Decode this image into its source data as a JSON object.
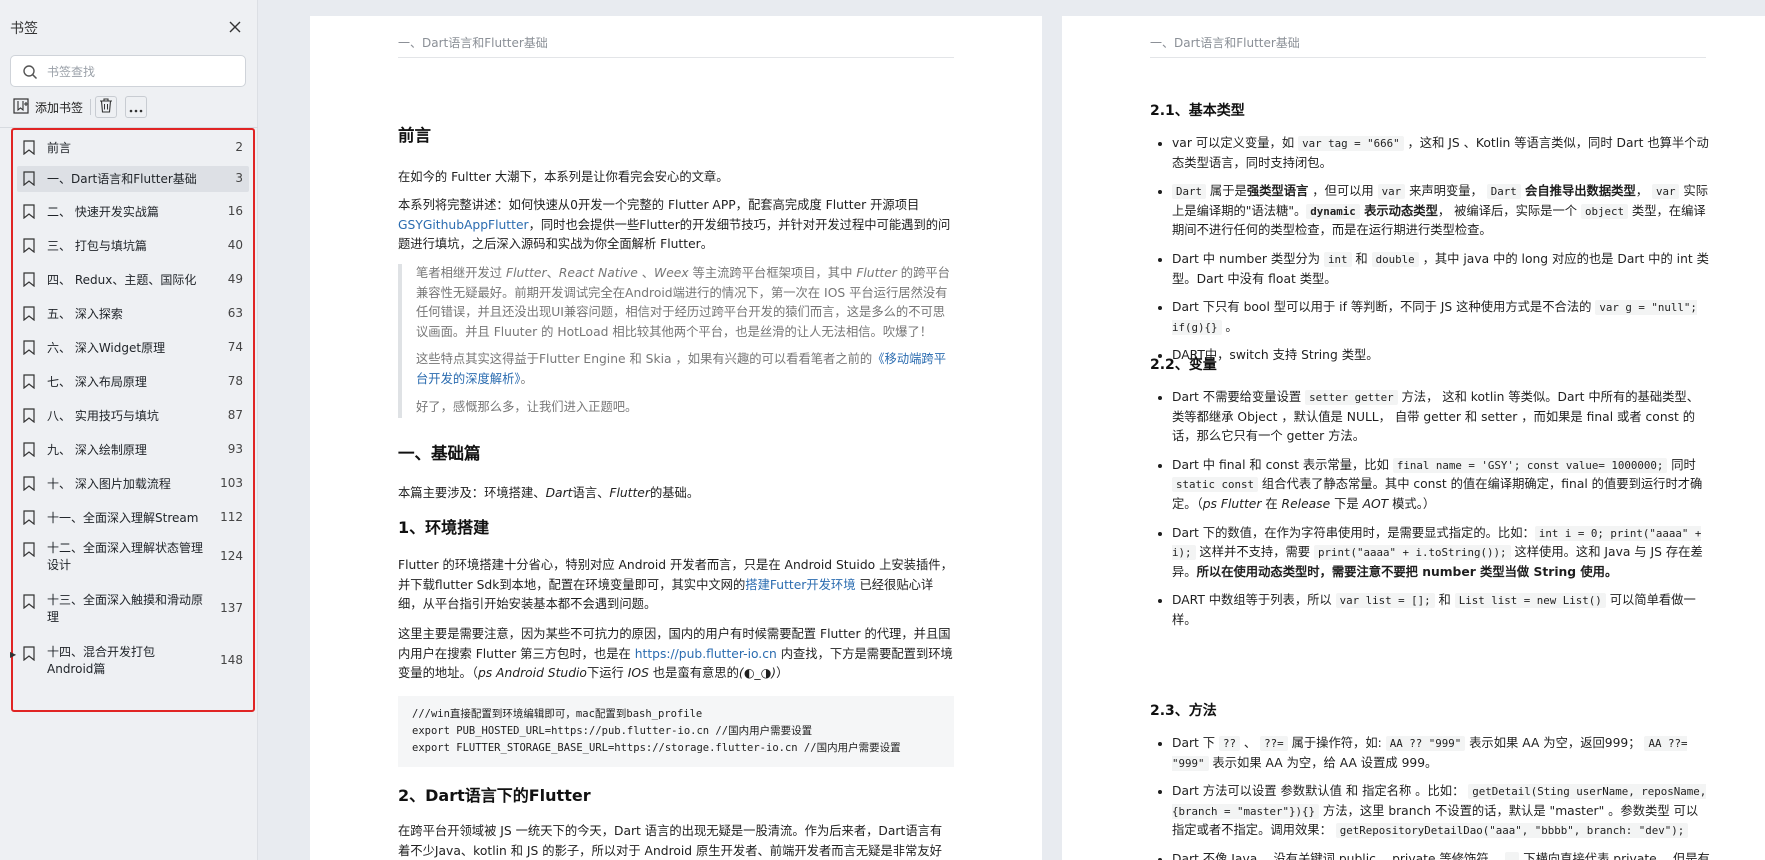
{
  "sidebar": {
    "title": "书签",
    "search_placeholder": "书签查找",
    "add_label": "添加书签",
    "items": [
      {
        "label": "前言",
        "page": "2"
      },
      {
        "label": "一、Dart语言和Flutter基础",
        "page": "3"
      },
      {
        "label": "二、 快速开发实战篇",
        "page": "16"
      },
      {
        "label": "三、 打包与填坑篇",
        "page": "40"
      },
      {
        "label": "四、 Redux、主题、国际化",
        "page": "49"
      },
      {
        "label": "五、 深入探索",
        "page": "63"
      },
      {
        "label": "六、 深入Widget原理",
        "page": "74"
      },
      {
        "label": "七、 深入布局原理",
        "page": "78"
      },
      {
        "label": "八、 实用技巧与填坑",
        "page": "87"
      },
      {
        "label": "九、 深入绘制原理",
        "page": "93"
      },
      {
        "label": "十、 深入图片加载流程",
        "page": "103"
      },
      {
        "label": "十一、全面深入理解Stream",
        "page": "112"
      },
      {
        "label": "十二、全面深入理解状态管理设计",
        "page": "124"
      },
      {
        "label": "十三、全面深入触摸和滑动原理",
        "page": "137"
      },
      {
        "label": "十四、混合开发打包 Android篇",
        "page": "148"
      }
    ]
  },
  "left_page": {
    "running_head": "一、Dart语言和Flutter基础",
    "h_preface": "前言",
    "p1": "在如今的 Fultter 大潮下，本系列是让你看完会安心的文章。",
    "p2a": "本系列将完整讲述：如何快速从0开发一个完整的 Flutter APP，配套高完成度 Flutter 开源项目",
    "p2_link": "GSYGithubAppFlutter",
    "p2b": "，同时也会提供一些Flutter的开发细节技巧，并针对开发过程中可能遇到的问题进行填坑，之后深入源码和实战为你全面解析 Flutter。",
    "q1a": "笔者相继开发过 ",
    "q1_i1": "Flutter",
    "q1b": "、",
    "q1_i2": "React Native",
    "q1c": " 、",
    "q1_i3": "Weex",
    "q1d": " 等主流跨平台框架项目，其中 ",
    "q1_i4": "Flutter",
    "q1e": " 的跨平台兼容性无疑最好。前期开发调试完全在Android端进行的情况下，第一次在 IOS 平台运行居然没有任何错误，并且还没出现UI兼容问题，相信对于经历过跨平台开发的猿们而言，这是多么的不可思议画面。并且 Fluuter 的 HotLoad 相比较其他两个平台，也是丝滑的让人无法相信。吹爆了！",
    "q2a": "这些特点其实这得益于Flutter Engine 和 Skia ，如果有兴趣的可以看看笔者之前的",
    "q2_link": "《移动端跨平台开发的深度解析》",
    "q2b": "。",
    "q3": "好了，感慨那么多，让我们进入正题吧。",
    "h_basic": "一、基础篇",
    "p3a": "本篇主要涉及：环境搭建、",
    "p3_i1": "Dart",
    "p3b": "语言、",
    "p3_i2": "Flutter",
    "p3c": "的基础。",
    "h_env": "1、环境搭建",
    "p4a": "Flutter 的环境搭建十分省心，特别对应 Android 开发者而言，只是在 Android Stuido 上安装插件，并下载flutter Sdk到本地，配置在环境变量即可，其实中文网的",
    "p4_link": "搭建Futter开发环境",
    "p4b": " 已经很贴心详细，从平台指引开始安装基本都不会遇到问题。",
    "p5a": "这里主要是需要注意，因为某些不可抗力的原因，国内的用户有时候需要配置 Flutter 的代理，并且国内用户在搜索 Flutter 第三方包时，也是在 ",
    "p5_link": "https://pub.flutter-io.cn",
    "p5b": " 内查找，下方是需要配置到环境变量的地址。（",
    "p5_i": "ps Android Studio",
    "p5c": "下运行 ",
    "p5_i2": "IOS",
    "p5d": " 也是蛮有意思的",
    "p5_i3": "(◐_◑)",
    "p5e": "）",
    "code": "///win直接配置到环境编辑即可，mac配置到bash_profile\nexport PUB_HOSTED_URL=https://pub.flutter-io.cn //国内用户需要设置\nexport FLUTTER_STORAGE_BASE_URL=https://storage.flutter-io.cn //国内用户需要设置",
    "h_dart": "2、Dart语言下的Flutter",
    "p6": "在跨平台开领域被 JS 一统天下的今天，Dart 语言的出现无疑是一股清流。作为后来者，Dart语言有着不少Java、kotlin 和 JS 的影子，所以对于 Android 原生开发者、前端开发者而言无疑是非常友好的。"
  },
  "right_page": {
    "running_head": "一、Dart语言和Flutter基础",
    "h21": "2.1、基本类型",
    "b1a": "var 可以定义变量，如 ",
    "b1_c": "var tag = \"666\"",
    "b1b": " ，这和 JS 、Kotlin 等语言类似，同时 Dart 也算半个动态类型语言，同时支持闭包。",
    "b2_c1": "Dart",
    "b2a": " 属于是",
    "b2_b1": "强类型语言",
    "b2b": " ，但可以用 ",
    "b2_c2": "var",
    "b2c": " 来声明变量， ",
    "b2_c3": "Dart",
    "b2_b2": " 会自推导出数据类型",
    "b2d": "， ",
    "b2_c4": "var",
    "b2e": " 实际上是编译期的\"语法糖\"。",
    "b2_c5": "dynamic",
    "b2_b3": " 表示动态类型",
    "b2f": "， 被编译后，实际是一个 ",
    "b2_c6": "object",
    "b2g": " 类型，在编译期间不进行任何的类型检查，而是在运行期进行类型检查。",
    "b3a": "Dart 中 number 类型分为 ",
    "b3_c1": "int",
    "b3b": " 和 ",
    "b3_c2": "double",
    "b3c": " ，其中 java 中的 long 对应的也是 Dart 中的 int 类型。Dart 中没有 float 类型。",
    "b4a": "Dart 下只有 bool 型可以用于 if 等判断，不同于 JS 这种使用方式是不合法的 ",
    "b4_c": "var g = \"null\"; if(g){}",
    "b4b": " 。",
    "b5": "DART中，switch 支持 String 类型。",
    "h22": "2.2、变量",
    "c1a": "Dart 不需要给变量设置 ",
    "c1_c": "setter getter",
    "c1b": " 方法， 这和 kotlin 等类似。Dart 中所有的基础类型、类等都继承 Object ，默认值是 NULL， 自带 getter 和 setter ，而如果是 final 或者 const 的话，那么它只有一个 getter 方法。",
    "c2a": "Dart 中 final 和 const 表示常量，比如 ",
    "c2_c1": "final name = 'GSY'; const value= 1000000;",
    "c2b": " 同时 ",
    "c2_c2": "static const",
    "c2c": " 组合代表了静态常量。其中 const 的值在编译期确定，final 的值要到运行时才确定。（",
    "c2_i": "ps Flutter",
    "c2d": " 在 ",
    "c2_i2": "Release",
    "c2e": " 下是 ",
    "c2_i3": "AOT",
    "c2f": " 模式。）",
    "c3a": "Dart 下的数值，在作为字符串使用时，是需要显式指定的。比如：",
    "c3_c1": "int i = 0; print(\"aaaa\" + i);",
    "c3b": " 这样并不支持，需要 ",
    "c3_c2": "print(\"aaaa\" + i.toString());",
    "c3c": " 这样使用。这和 Java 与 JS 存在差异。",
    "c3_b": "所以在使用动态类型时，需要注意不要把 number 类型当做 String 使用。",
    "c4a": "DART 中数组等于列表，所以 ",
    "c4_c1": "var list = [];",
    "c4b": " 和 ",
    "c4_c2": "List list = new List()",
    "c4c": " 可以简单看做一样。",
    "h23": "2.3、方法",
    "d1a": "Dart 下 ",
    "d1_c1": "??",
    "d1b": " 、 ",
    "d1_c2": "??=",
    "d1c": " 属于操作符，如: ",
    "d1_c3": "AA ?? \"999\"",
    "d1d": " 表示如果 AA 为空，返回999； ",
    "d1_c4": "AA ??= \"999\"",
    "d1e": " 表示如果 AA 为空，给 AA 设置成 999。",
    "d2a": "Dart 方法可以设置 参数默认值 和 指定名称 。比如： ",
    "d2_c1": "getDetail(Sting userName, reposName, {branch = \"master\"}){}",
    "d2b": " 方法，这里 branch 不设置的话，默认是 \"master\" 。参数类型 可以指定或者不指定。调用效果： ",
    "d2_c2": "getRepositoryDetailDao(\"aaa\", \"bbbb\", branch: \"dev\");",
    "d3a": "Dart 不像 Java ，没有关键词 public 、private 等修饰符， ",
    "d3_c": "_",
    "d3b": " 下横向直接代表 private ，但是有"
  }
}
